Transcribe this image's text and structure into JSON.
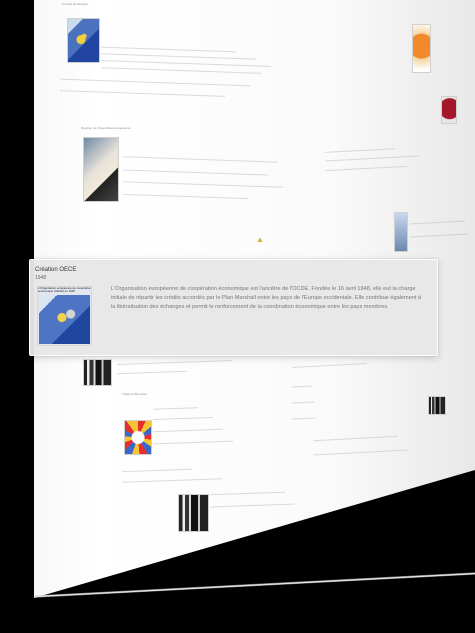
{
  "popup": {
    "title": "Création OECE",
    "year": "1948",
    "map_caption": "L'Organisation européenne de coopération économique (OECE) en 1948",
    "description": "L'Organisation européenne de coopération économique est l'ancêtre de l'OCDE. Fondée le 16 avril 1948, elle eut la charge initiale de répartir les crédits accordés par le Plan Marshall entre les pays de l'Europe occidentale. Elle contribue également à la libéralisation des échanges et permit le renforcement de la coordination économique entre les pays membres."
  },
  "background": {
    "top_label": "Conseil de l'Europe",
    "section_label": "Réunion de l'Assemblée Européenne",
    "bottom_label": "Traité de Bruxelles"
  },
  "colors": {
    "page": "#ffffff",
    "popup": "#e7e7e7",
    "popup_text": "#777777",
    "map_blue": "#1e469e",
    "map_yellow": "#f7d34d"
  }
}
